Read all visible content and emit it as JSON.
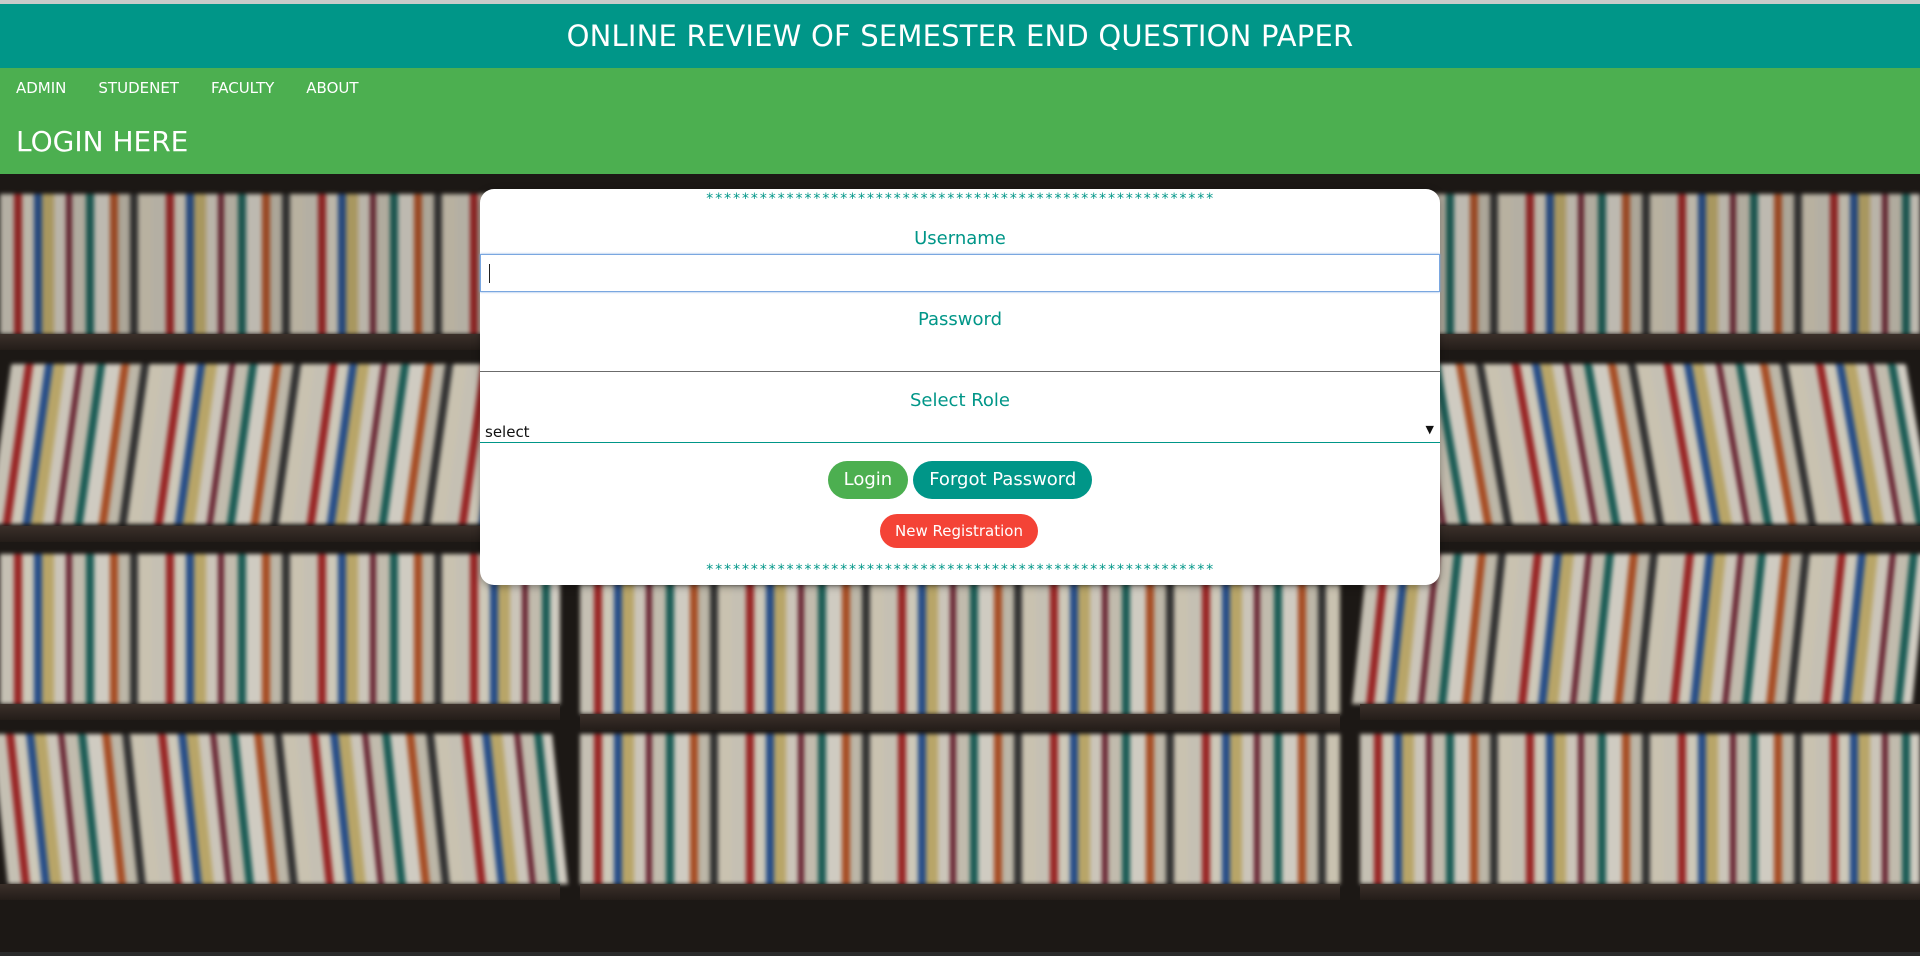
{
  "header": {
    "title": "ONLINE REVIEW OF SEMESTER END QUESTION PAPER"
  },
  "nav": {
    "items": [
      {
        "label": "ADMIN"
      },
      {
        "label": "STUDENET"
      },
      {
        "label": "FACULTY"
      },
      {
        "label": "ABOUT"
      }
    ]
  },
  "page": {
    "subtitle": "LOGIN HERE"
  },
  "login": {
    "decoration": "*********************************************************",
    "username_label": "Username",
    "username_value": "",
    "password_label": "Password",
    "password_value": "",
    "role_label": "Select Role",
    "role_selected": "select",
    "login_button": "Login",
    "forgot_button": "Forgot Password",
    "register_button": "New Registration"
  },
  "colors": {
    "primary": "#009688",
    "nav": "#4caf50",
    "danger": "#f44336"
  },
  "icons": {
    "select_arrow": "dropdown-arrow-icon",
    "background": "bookshelf-background-image"
  }
}
